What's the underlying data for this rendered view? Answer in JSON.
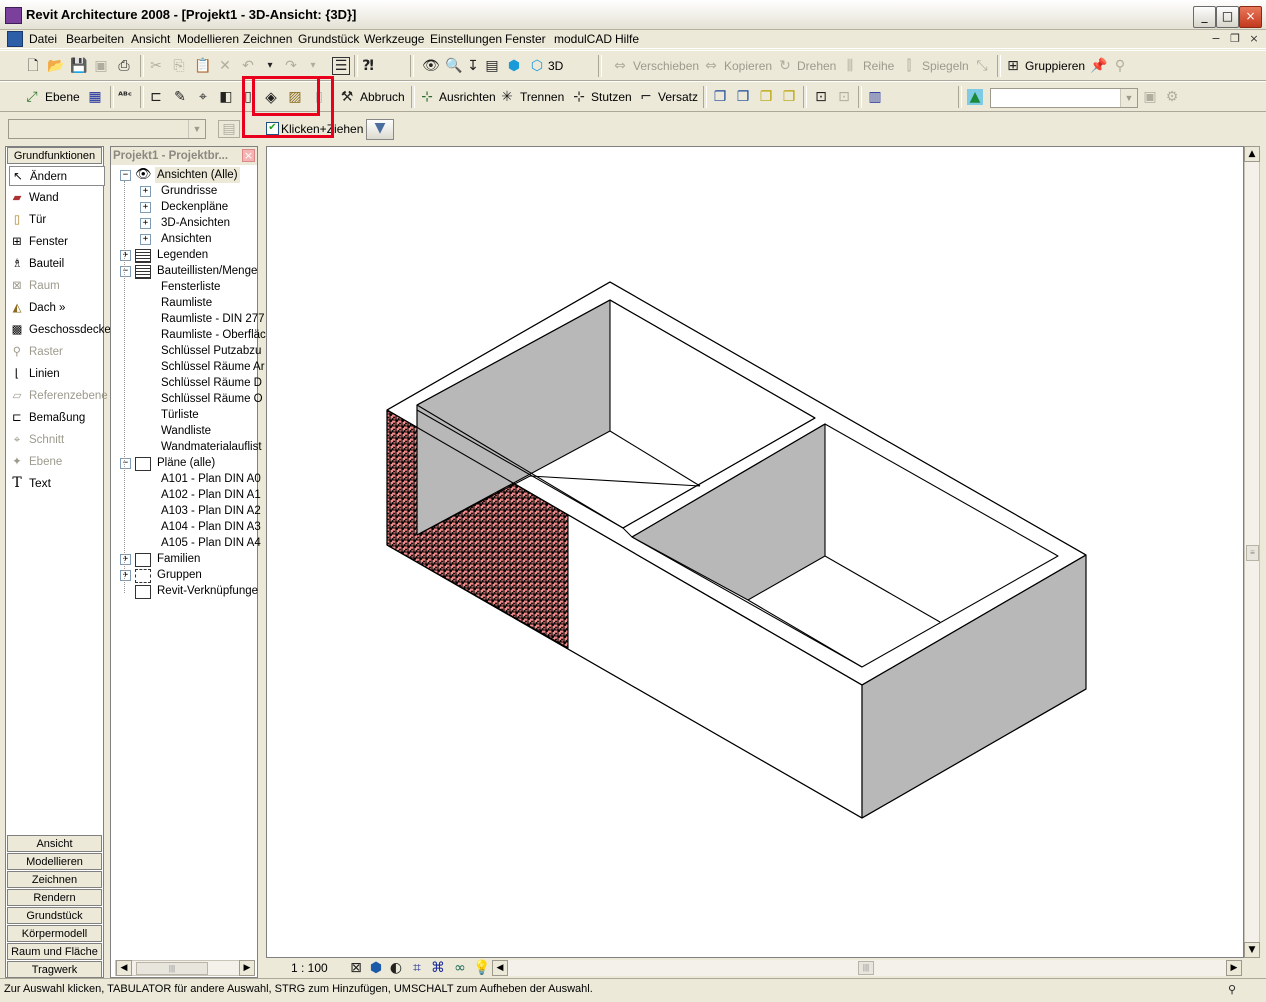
{
  "window": {
    "title": "Revit Architecture 2008 - [Projekt1 - 3D-Ansicht: {3D}]",
    "minimize": "_",
    "maximize": "□",
    "close": "×"
  },
  "menu": [
    "Datei",
    "Bearbeiten",
    "Ansicht",
    "Modellieren",
    "Zeichnen",
    "Grundstück",
    "Werkzeuge",
    "Einstellungen",
    "Fenster",
    "modulCAD",
    "Hilfe"
  ],
  "toolbar1": {
    "view3d_label": "3D",
    "move": "Verschieben",
    "copy": "Kopieren",
    "rotate": "Drehen",
    "array": "Reihe",
    "mirror": "Spiegeln",
    "group": "Gruppieren"
  },
  "toolbar2": {
    "level": "Ebene",
    "demolish": "Abbruch",
    "align": "Ausrichten",
    "split": "Trennen",
    "trim": "Stutzen",
    "offset": "Versatz"
  },
  "options_bar": {
    "drag_checkbox_label": "Klicken+Ziehen",
    "drag_checked": true
  },
  "design_bar": {
    "active_tab": "Grundfunktionen",
    "items": [
      {
        "label": "Ändern",
        "icon": "cursor-arrow-icon",
        "disabled": false,
        "selected": true
      },
      {
        "label": "Wand",
        "icon": "wall-icon",
        "disabled": false
      },
      {
        "label": "Tür",
        "icon": "door-icon",
        "disabled": false
      },
      {
        "label": "Fenster",
        "icon": "window-icon",
        "disabled": false
      },
      {
        "label": "Bauteil",
        "icon": "component-icon",
        "disabled": false
      },
      {
        "label": "Raum",
        "icon": "room-icon",
        "disabled": true
      },
      {
        "label": "Dach »",
        "icon": "roof-icon",
        "disabled": false
      },
      {
        "label": "Geschossdecke",
        "icon": "floor-icon",
        "disabled": false
      },
      {
        "label": "Raster",
        "icon": "grid-icon",
        "disabled": true
      },
      {
        "label": "Linien",
        "icon": "lines-icon",
        "disabled": false
      },
      {
        "label": "Referenzebene",
        "icon": "ref-plane-icon",
        "disabled": true
      },
      {
        "label": "Bemaßung",
        "icon": "dimension-icon",
        "disabled": false
      },
      {
        "label": "Schnitt",
        "icon": "section-icon",
        "disabled": true
      },
      {
        "label": "Ebene",
        "icon": "level-icon",
        "disabled": true
      },
      {
        "label": "Text",
        "icon": "text-icon",
        "disabled": false
      }
    ],
    "tabs": [
      "Ansicht",
      "Modellieren",
      "Zeichnen",
      "Rendern",
      "Grundstück",
      "Körpermodell",
      "Raum und Fläche",
      "Tragwerk"
    ]
  },
  "project_browser": {
    "title": "Projekt1 - Projektbr...",
    "nodes": [
      {
        "label": "Ansichten (Alle)",
        "level": 0,
        "box": "−",
        "icon": "eye-icon"
      },
      {
        "label": "Grundrisse",
        "level": 1,
        "box": "+"
      },
      {
        "label": "Deckenpläne",
        "level": 1,
        "box": "+"
      },
      {
        "label": "3D-Ansichten",
        "level": 1,
        "box": "+"
      },
      {
        "label": "Ansichten",
        "level": 1,
        "box": "+"
      },
      {
        "label": "Legenden",
        "level": 0,
        "box": "+",
        "icon": "legend-icon"
      },
      {
        "label": "Bauteillisten/Menge",
        "level": 0,
        "box": "−",
        "icon": "schedule-icon"
      },
      {
        "label": "Fensterliste",
        "level": 2
      },
      {
        "label": "Raumliste",
        "level": 2
      },
      {
        "label": "Raumliste - DIN 277",
        "level": 2
      },
      {
        "label": "Raumliste - Oberfläc",
        "level": 2
      },
      {
        "label": "Schlüssel Putzabzu",
        "level": 2
      },
      {
        "label": "Schlüssel Räume Ar",
        "level": 2
      },
      {
        "label": "Schlüssel Räume D",
        "level": 2
      },
      {
        "label": "Schlüssel Räume O",
        "level": 2
      },
      {
        "label": "Türliste",
        "level": 2
      },
      {
        "label": "Wandliste",
        "level": 2
      },
      {
        "label": "Wandmaterialauflist",
        "level": 2
      },
      {
        "label": "Pläne (alle)",
        "level": 0,
        "box": "−",
        "icon": "sheet-icon"
      },
      {
        "label": "A101 - Plan DIN A0",
        "level": 2
      },
      {
        "label": "A102 - Plan DIN A1",
        "level": 2
      },
      {
        "label": "A103 - Plan DIN A2",
        "level": 2
      },
      {
        "label": "A104 - Plan DIN A3",
        "level": 2
      },
      {
        "label": "A105 - Plan DIN A4",
        "level": 2
      },
      {
        "label": "Familien",
        "level": 0,
        "box": "+",
        "icon": "family-icon"
      },
      {
        "label": "Gruppen",
        "level": 0,
        "box": "+",
        "icon": "group-icon"
      },
      {
        "label": "Revit-Verknüpfunge",
        "level": 0,
        "icon": "link-icon"
      }
    ]
  },
  "view_control": {
    "scale": "1 : 100"
  },
  "status_bar": {
    "text": "Zur Auswahl klicken, TABULATOR für andere Auswahl, STRG zum Hinzufügen, UMSCHALT zum Aufheben der Auswahl."
  },
  "colors": {
    "highlight_box": "#e8001c",
    "painted_face": "#f28b8b",
    "shaded_face": "#b8b8b8"
  }
}
